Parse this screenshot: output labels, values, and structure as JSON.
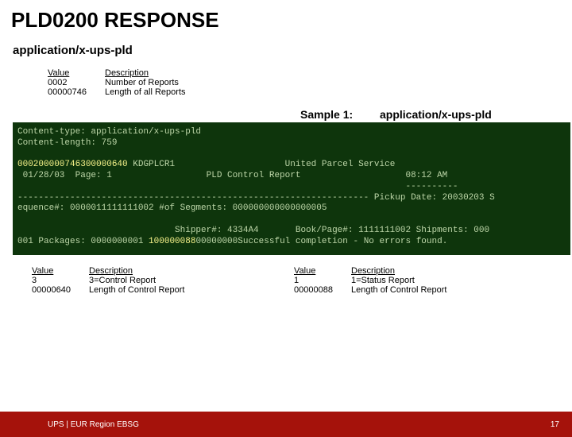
{
  "title": "PLD0200 RESPONSE",
  "subtitle": "application/x-ups-pld",
  "top_table": {
    "header": {
      "c1": "Value",
      "c2": "Description"
    },
    "rows": [
      {
        "c1": "0002",
        "c2": "Number of Reports"
      },
      {
        "c1": "00000746",
        "c2": "Length of all Reports"
      }
    ]
  },
  "sample": {
    "label": "Sample 1:",
    "value": "application/x-ups-pld"
  },
  "code": {
    "l1": "Content-type: application/x-ups-pld",
    "l2": "Content-length: 759",
    "l3": "",
    "l4a": "0002",
    "l4b": "00000746",
    "l4c": "3",
    "l4d": "00000640",
    "l4e": " KDGPLCR1                     United Parcel Service",
    "l5": " 01/28/03  Page: 1                  PLD Control Report                    08:12 AM",
    "l6": "                                                                          ----------",
    "l7": "------------------------------------------------------------------- Pickup Date: 20030203 S",
    "l8": "equence#: 0000011111111002 #of Segments: 000000000000000005",
    "l9": "",
    "l10": "                              Shipper#: 4334A4       Book/Page#: 1111111002 Shipments: 000",
    "l11a": "001 Packages: 0000000001 ",
    "l11b": "1",
    "l11c": "00000088",
    "l11d": "00000000Successful completion - No errors found."
  },
  "bottom_left": {
    "header": {
      "c1": "Value",
      "c2": "Description"
    },
    "rows": [
      {
        "c1": "3",
        "c2": "3=Control Report"
      },
      {
        "c1": "00000640",
        "c2": "Length of Control Report"
      }
    ]
  },
  "bottom_right": {
    "header": {
      "c1": "Value",
      "c2": "Description"
    },
    "rows": [
      {
        "c1": "1",
        "c2": "1=Status Report"
      },
      {
        "c1": "00000088",
        "c2": "Length of Control Report"
      }
    ]
  },
  "footer": {
    "left": "UPS | EUR Region EBSG",
    "right": "17"
  }
}
